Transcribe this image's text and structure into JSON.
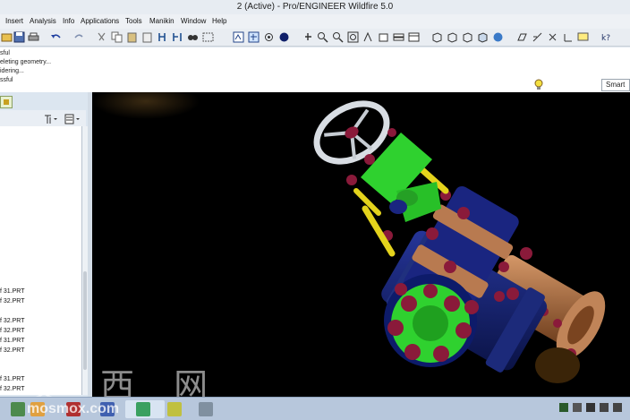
{
  "window": {
    "title": "2 (Active) - Pro/ENGINEER Wildfire 5.0"
  },
  "menu": [
    "Insert",
    "Analysis",
    "Info",
    "Applications",
    "Tools",
    "Manikin",
    "Window",
    "Help"
  ],
  "messages": [
    "sful",
    "eleting geometry...",
    "idering...",
    "ssful"
  ],
  "filter": {
    "value": "Smart"
  },
  "model_tree": {
    "items": [
      "f 31.PRT",
      "f 32.PRT",
      "f 32.PRT",
      "f 32.PRT",
      "f 31.PRT",
      "f 32.PRT",
      "f 31.PRT",
      "f 32.PRT"
    ]
  },
  "watermark": {
    "chars": "莫 西 网",
    "url": "mosmox.com"
  },
  "colors": {
    "viewport_bg": "#000000",
    "accent_green": "#2fd12f",
    "bolt_red": "#8a1a3a",
    "valve_blue": "#1a2a8a",
    "flange_tan": "#b87a50"
  }
}
